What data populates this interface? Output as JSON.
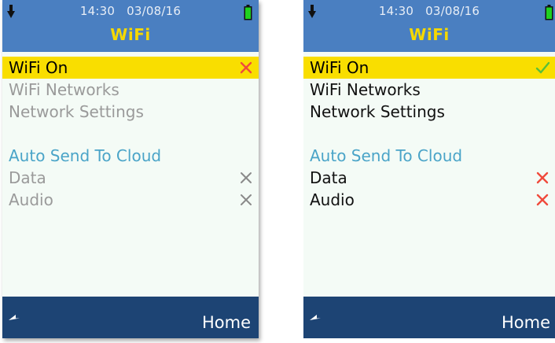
{
  "screens": [
    {
      "status": {
        "time": "14:30",
        "date": "03/08/16"
      },
      "title": "WiFi",
      "items": [
        {
          "label": "WiFi On",
          "state": "cross",
          "style": "selected"
        },
        {
          "label": "WiFi Networks",
          "state": "none",
          "style": "disabled"
        },
        {
          "label": "Network Settings",
          "state": "none",
          "style": "disabled"
        }
      ],
      "section_heading": "Auto Send To Cloud",
      "section_items": [
        {
          "label": "Data",
          "state": "cross-gray",
          "style": "disabled"
        },
        {
          "label": "Audio",
          "state": "cross-gray",
          "style": "disabled"
        }
      ],
      "footer": {
        "home_label": "Home"
      }
    },
    {
      "status": {
        "time": "14:30",
        "date": "03/08/16"
      },
      "title": "WiFi",
      "items": [
        {
          "label": "WiFi On",
          "state": "check",
          "style": "selected"
        },
        {
          "label": "WiFi Networks",
          "state": "none",
          "style": "enabled"
        },
        {
          "label": "Network Settings",
          "state": "none",
          "style": "enabled"
        }
      ],
      "section_heading": "Auto Send To Cloud",
      "section_items": [
        {
          "label": "Data",
          "state": "cross",
          "style": "enabled"
        },
        {
          "label": "Audio",
          "state": "cross",
          "style": "enabled"
        }
      ],
      "footer": {
        "home_label": "Home"
      }
    }
  ],
  "colors": {
    "header_bg": "#4a7fc1",
    "title": "#f5d800",
    "selected_row": "#f9de00",
    "section_heading": "#4aa4c8",
    "footer_bg": "#1d4474",
    "cross_red": "#f04a3c",
    "cross_gray": "#8a8a8a",
    "check_green": "#58c03a",
    "battery_green": "#20d020"
  },
  "icons": {
    "status_left": "download-icon",
    "status_right": "battery-icon",
    "footer_left": "back-icon"
  }
}
